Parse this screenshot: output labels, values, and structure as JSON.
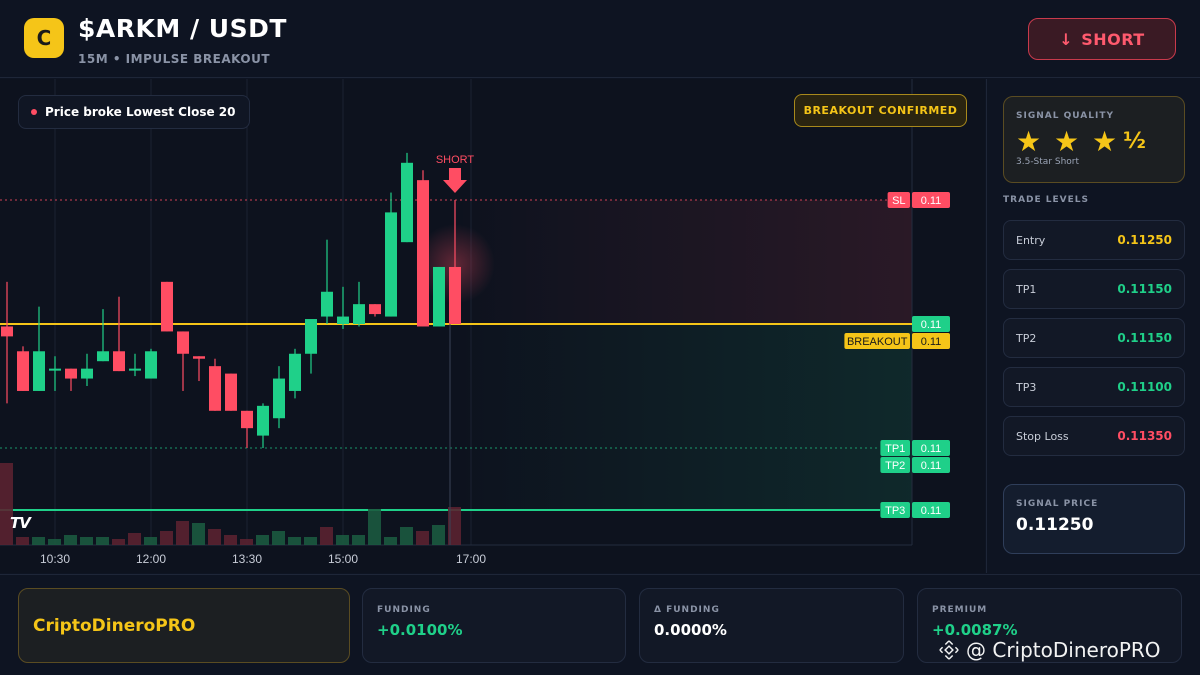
{
  "header": {
    "logo_letter": "C",
    "pair": "$ARKM / USDT",
    "subtitle": "15M • IMPULSE BREAKOUT",
    "short_arrow": "↓",
    "short_label": "SHORT"
  },
  "chart": {
    "alert_text": "Price broke Lowest Close 20",
    "confirmed_label": "BREAKOUT CONFIRMED",
    "short_marker_text": "SHORT",
    "tv_logo": "TV",
    "x_ticks": [
      "10:30",
      "12:00",
      "13:30",
      "15:00",
      "17:00"
    ],
    "level_tags": [
      {
        "name": "SL",
        "value": "0.11"
      },
      {
        "name": "",
        "value": "0.11"
      },
      {
        "name": "BREAKOUT",
        "value": "0.11"
      },
      {
        "name": "TP1",
        "value": "0.11"
      },
      {
        "name": "TP2",
        "value": "0.11"
      },
      {
        "name": "TP3",
        "value": "0.11"
      }
    ]
  },
  "chart_data": {
    "type": "candlestick",
    "x_labels": [
      "10:30",
      "12:00",
      "13:30",
      "15:00",
      "17:00"
    ],
    "levels": {
      "SL": 0.1135,
      "entry": 0.1125,
      "breakout": 0.1125,
      "TP1": 0.1115,
      "TP2": 0.1115,
      "TP3": 0.111
    },
    "candles": [
      {
        "o": 0.11248,
        "h": 0.11284,
        "l": 0.11186,
        "c": 0.1124
      },
      {
        "o": 0.11228,
        "h": 0.11232,
        "l": 0.11196,
        "c": 0.11196
      },
      {
        "o": 0.11196,
        "h": 0.11264,
        "l": 0.11196,
        "c": 0.11228
      },
      {
        "o": 0.11214,
        "h": 0.11224,
        "l": 0.11196,
        "c": 0.11214
      },
      {
        "o": 0.11214,
        "h": 0.11214,
        "l": 0.11196,
        "c": 0.11206
      },
      {
        "o": 0.11206,
        "h": 0.11226,
        "l": 0.112,
        "c": 0.11214
      },
      {
        "o": 0.1122,
        "h": 0.11262,
        "l": 0.1122,
        "c": 0.11228
      },
      {
        "o": 0.11228,
        "h": 0.11272,
        "l": 0.11212,
        "c": 0.11212
      },
      {
        "o": 0.11214,
        "h": 0.11226,
        "l": 0.11208,
        "c": 0.11214
      },
      {
        "o": 0.11206,
        "h": 0.1123,
        "l": 0.11206,
        "c": 0.11228
      },
      {
        "o": 0.11284,
        "h": 0.11284,
        "l": 0.11244,
        "c": 0.11244
      },
      {
        "o": 0.11244,
        "h": 0.11244,
        "l": 0.11196,
        "c": 0.11226
      },
      {
        "o": 0.11224,
        "h": 0.11224,
        "l": 0.11204,
        "c": 0.11222
      },
      {
        "o": 0.11216,
        "h": 0.11222,
        "l": 0.1118,
        "c": 0.1118
      },
      {
        "o": 0.1121,
        "h": 0.1121,
        "l": 0.1118,
        "c": 0.1118
      },
      {
        "o": 0.1118,
        "h": 0.1118,
        "l": 0.1115,
        "c": 0.11166
      },
      {
        "o": 0.1116,
        "h": 0.11186,
        "l": 0.1115,
        "c": 0.11184
      },
      {
        "o": 0.11174,
        "h": 0.11216,
        "l": 0.11166,
        "c": 0.11206
      },
      {
        "o": 0.11196,
        "h": 0.1123,
        "l": 0.1119,
        "c": 0.11226
      },
      {
        "o": 0.11226,
        "h": 0.1125,
        "l": 0.1121,
        "c": 0.11254
      },
      {
        "o": 0.11256,
        "h": 0.11318,
        "l": 0.1125,
        "c": 0.11276
      },
      {
        "o": 0.1125,
        "h": 0.1128,
        "l": 0.11246,
        "c": 0.11256
      },
      {
        "o": 0.1125,
        "h": 0.11284,
        "l": 0.11248,
        "c": 0.11266
      },
      {
        "o": 0.11266,
        "h": 0.11266,
        "l": 0.11256,
        "c": 0.11258
      },
      {
        "o": 0.11256,
        "h": 0.11356,
        "l": 0.11256,
        "c": 0.1134
      },
      {
        "o": 0.11316,
        "h": 0.11388,
        "l": 0.11316,
        "c": 0.1138
      },
      {
        "o": 0.11366,
        "h": 0.11374,
        "l": 0.11248,
        "c": 0.11248
      },
      {
        "o": 0.11248,
        "h": 0.11296,
        "l": 0.11248,
        "c": 0.11296
      },
      {
        "o": 0.11296,
        "h": 0.1135,
        "l": 0.1125,
        "c": 0.1125
      }
    ],
    "volume": [
      82,
      8,
      8,
      6,
      10,
      8,
      8,
      6,
      12,
      8,
      14,
      24,
      22,
      16,
      10,
      6,
      10,
      14,
      8,
      8,
      18,
      10,
      10,
      36,
      8,
      18,
      14,
      20,
      38
    ],
    "volume_up": [
      false,
      false,
      true,
      true,
      true,
      true,
      true,
      false,
      false,
      true,
      false,
      false,
      true,
      false,
      false,
      false,
      true,
      true,
      true,
      true,
      false,
      true,
      true,
      true,
      true,
      true,
      false,
      true,
      false
    ]
  },
  "right_panel": {
    "quality_title": "SIGNAL QUALITY",
    "stars_text": "★ ★ ★",
    "half_text": "½",
    "quality_sub": "3.5-Star Short",
    "levels_title": "TRADE LEVELS",
    "levels": [
      {
        "label": "Entry",
        "value": "0.11250",
        "color": "#f5c518"
      },
      {
        "label": "TP1",
        "value": "0.11150",
        "color": "#1fd089"
      },
      {
        "label": "TP2",
        "value": "0.11150",
        "color": "#1fd089"
      },
      {
        "label": "TP3",
        "value": "0.11100",
        "color": "#1fd089"
      },
      {
        "label": "Stop Loss",
        "value": "0.11350",
        "color": "#ff4d63"
      }
    ],
    "signal_price_title": "SIGNAL PRICE",
    "signal_price_value": "0.11250"
  },
  "bottom": {
    "brand": "CriptoDineroPRO",
    "stats": [
      {
        "title": "FUNDING",
        "value": "+0.0100%",
        "color": "#1fd089"
      },
      {
        "title": "Δ FUNDING",
        "value": "0.0000%",
        "color": "#ffffff"
      },
      {
        "title": "PREMIUM",
        "value": "+0.0087%",
        "color": "#1fd089"
      }
    ],
    "watermark": "@ CriptoDineroPRO"
  },
  "colors": {
    "up": "#1fd089",
    "down": "#ff4d63",
    "accent": "#f5c518",
    "bg": "#0e1422"
  }
}
